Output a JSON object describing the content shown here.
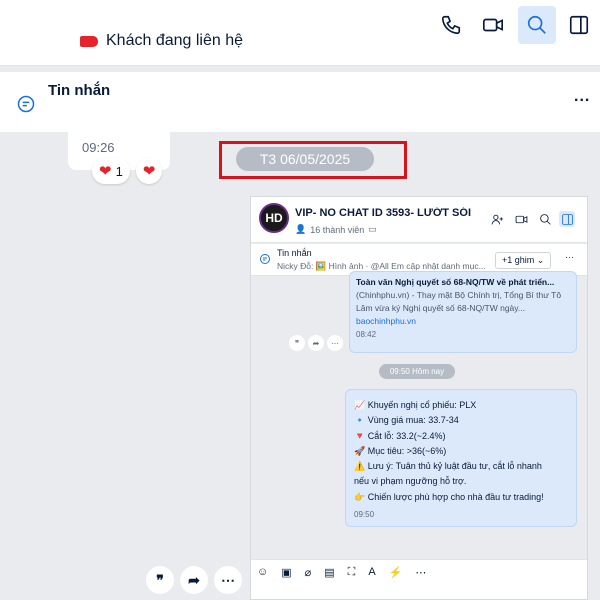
{
  "topbar": {
    "status_label": "Khách đang liên hệ",
    "icons": [
      "phone-icon",
      "video-icon",
      "search-icon",
      "panel-icon"
    ]
  },
  "messages_header": {
    "title": "Tin nhắn",
    "more": "..."
  },
  "chat": {
    "prev_time": "09:26",
    "reaction_count": "1",
    "date_separator": "T3 06/05/2025"
  },
  "shot": {
    "avatar": "HD",
    "group_name": "VIP- NO CHAT ID 3593- LƯỚT SÓI",
    "members": "16 thành viên",
    "pin_title": "Tin nhắn",
    "pin_sub": "Nicky Đỗ: 🖼️ Hình ảnh · @All Em cập nhật danh mục...",
    "pin_button": "+1 ghim ⌄",
    "pin_more": "···",
    "msg1": {
      "title": "Toàn văn Nghị quyết số 68-NQ/TW về phát triển...",
      "body": "(Chinhphu.vn) - Thay mặt Bộ Chính trị, Tổng Bí thư Tô Lâm vừa ký Nghị quyết số 68-NQ/TW ngày...",
      "link": "baochinhphu.vn",
      "time": "08:42"
    },
    "day_pill": "09:50 Hôm nay",
    "msg2": {
      "lines": [
        "📈 Khuyến nghị cổ phiếu: PLX",
        "🔹 Vùng giá mua: 33.7-34",
        "🔻 Cắt lỗ: 33.2(~2.4%)",
        "🚀 Mục tiêu: >36(~6%)",
        "⚠️ Lưu ý: Tuân thủ kỷ luật đầu tư, cắt lỗ nhanh",
        "nếu vi phạm ngưỡng hỗ trợ.",
        "👉 Chiến lược phù hợp cho nhà đầu tư trading!"
      ],
      "time": "09:50"
    }
  }
}
